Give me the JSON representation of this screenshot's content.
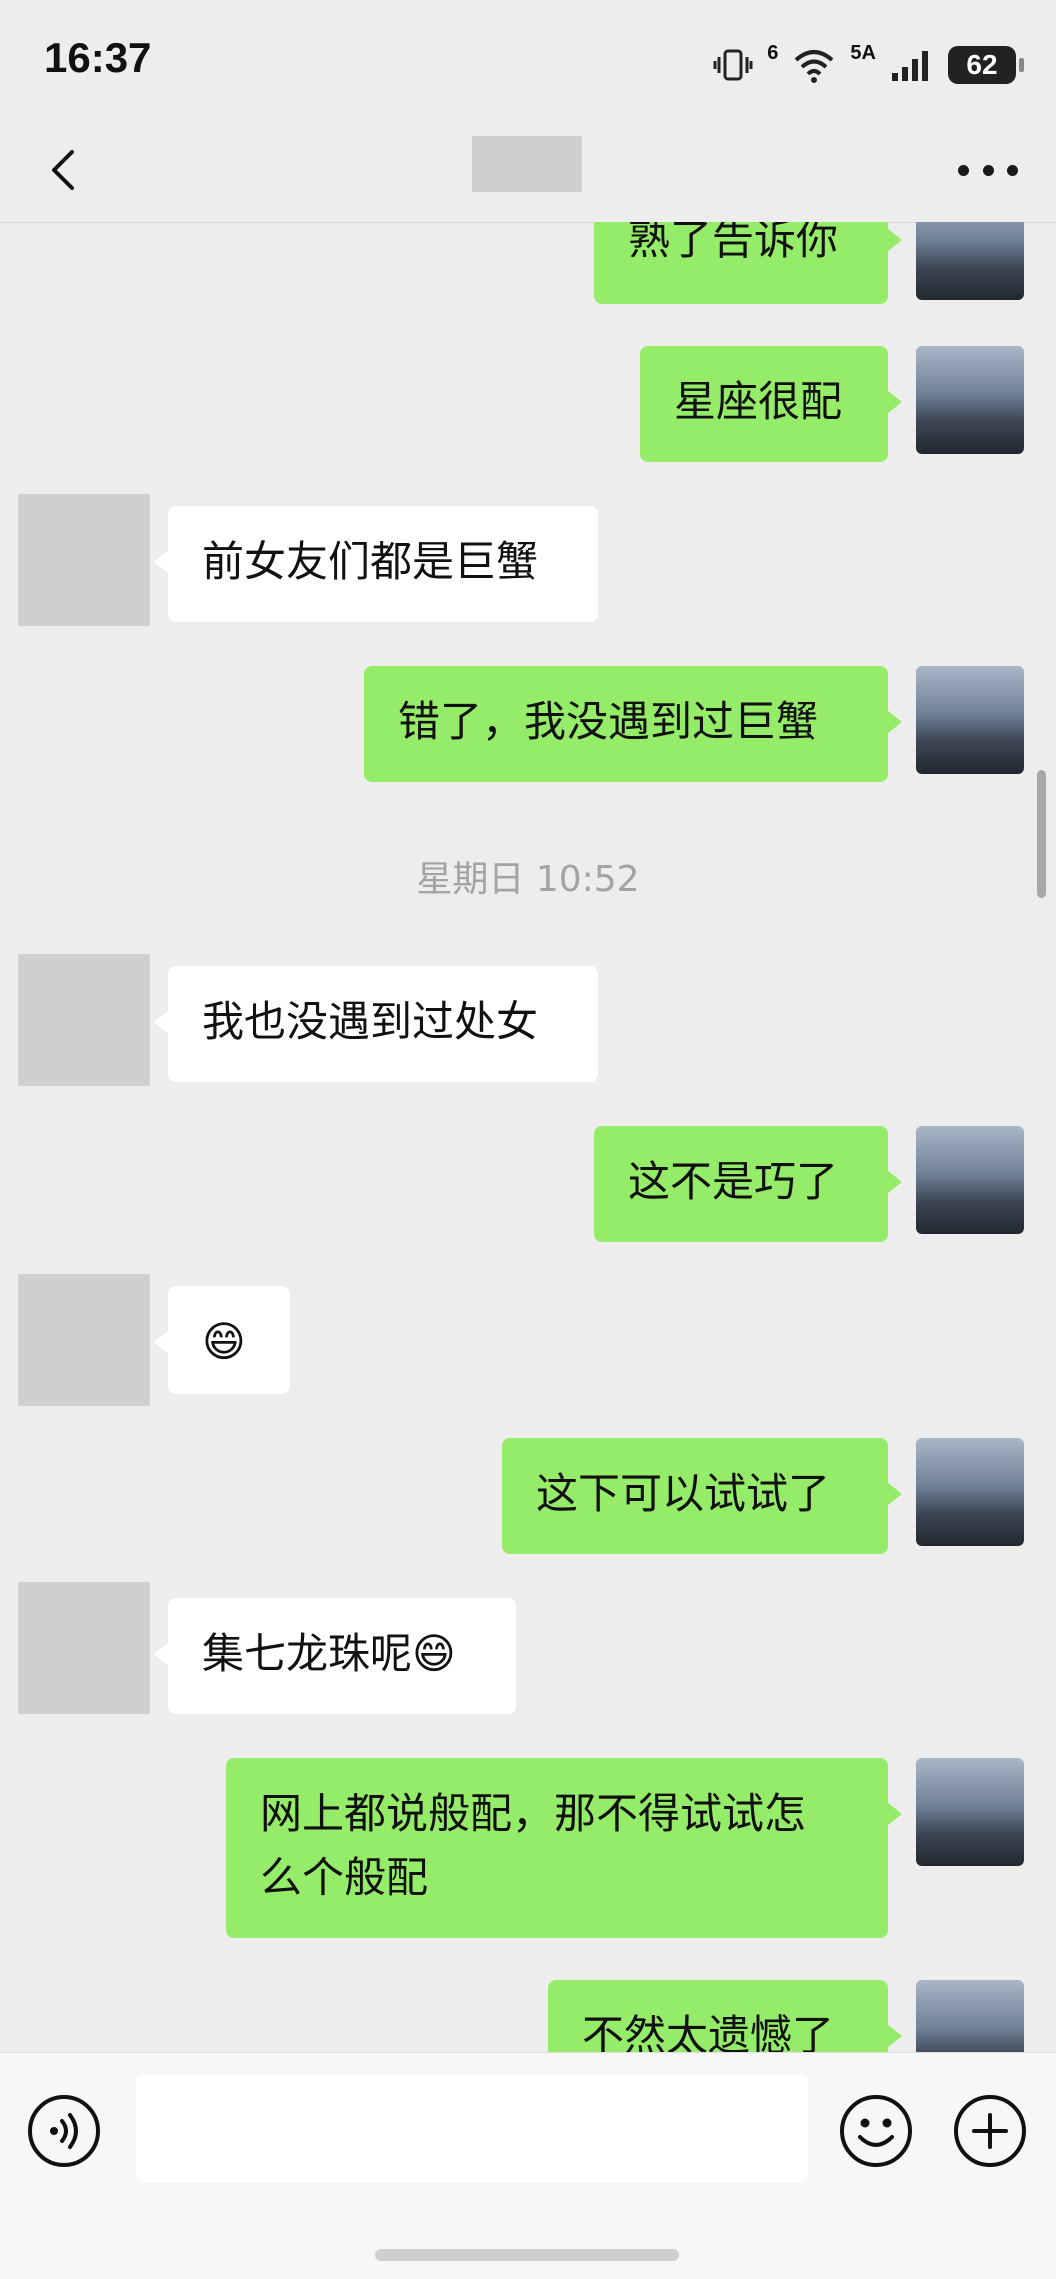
{
  "status_bar": {
    "time": "16:37",
    "network": "5A",
    "wifi_label": "6",
    "battery": "62"
  },
  "header": {
    "back_icon": "chevron-left-icon",
    "more_icon": "more-horizontal-icon"
  },
  "messages": [
    {
      "id": "m1",
      "from": "me",
      "text": "熟了告诉你"
    },
    {
      "id": "m2",
      "from": "me",
      "text": "星座很配"
    },
    {
      "id": "m3",
      "from": "other",
      "text": "前女友们都是巨蟹"
    },
    {
      "id": "m4",
      "from": "me",
      "text": "错了，我没遇到过巨蟹"
    },
    {
      "id": "ts1",
      "type": "timestamp",
      "text": "星期日 10:52"
    },
    {
      "id": "m5",
      "from": "other",
      "text": "我也没遇到过处女"
    },
    {
      "id": "m6",
      "from": "me",
      "text": "这不是巧了"
    },
    {
      "id": "m7",
      "from": "other",
      "text": "😄"
    },
    {
      "id": "m8",
      "from": "me",
      "text": "这下可以试试了"
    },
    {
      "id": "m9",
      "from": "other",
      "text": "集七龙珠呢😄"
    },
    {
      "id": "m10",
      "from": "me",
      "text_line1": "网上都说般配，那不得试试怎",
      "text_line2": "么个般配"
    },
    {
      "id": "m11",
      "from": "me",
      "text": "不然太遗憾了"
    }
  ],
  "input_bar": {
    "voice_icon": "voice-icon",
    "emoji_icon": "emoji-icon",
    "plus_icon": "plus-icon",
    "placeholder": ""
  }
}
